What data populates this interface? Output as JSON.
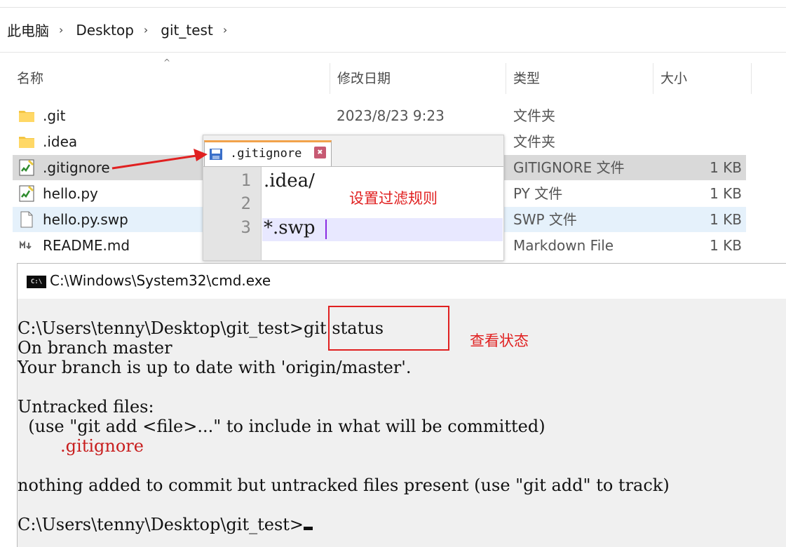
{
  "breadcrumb": {
    "items": [
      "此电脑",
      "Desktop",
      "git_test"
    ]
  },
  "columns": {
    "name": "名称",
    "date": "修改日期",
    "type": "类型",
    "size": "大小"
  },
  "files": [
    {
      "name": ".git",
      "date": "2023/8/23 9:23",
      "type": "文件夹",
      "size": "",
      "icon": "folder-icon"
    },
    {
      "name": ".idea",
      "date": "",
      "type": "文件夹",
      "size": "",
      "icon": "folder-icon"
    },
    {
      "name": ".gitignore",
      "date": "",
      "type": "GITIGNORE 文件",
      "size": "1 KB",
      "icon": "notepad-file-icon"
    },
    {
      "name": "hello.py",
      "date": "",
      "type": "PY 文件",
      "size": "1 KB",
      "icon": "notepad-file-icon"
    },
    {
      "name": "hello.py.swp",
      "date": "",
      "type": "SWP 文件",
      "size": "1 KB",
      "icon": "blank-file-icon"
    },
    {
      "name": "README.md",
      "date": "",
      "type": "Markdown File",
      "size": "1 KB",
      "icon": "markdown-file-icon"
    }
  ],
  "editor": {
    "tab": ".gitignore",
    "close_glyph": "✖",
    "lines": [
      {
        "num": "1",
        "text": ".idea/"
      },
      {
        "num": "2",
        "text": ""
      },
      {
        "num": "3",
        "text": "*.swp"
      }
    ]
  },
  "annotations": {
    "filter_rules": "设置过滤规则",
    "check_status": "查看状态"
  },
  "cmd": {
    "title": "C:\\Windows\\System32\\cmd.exe",
    "icon_text": "C:\\",
    "lines": [
      "C:\\Users\\tenny\\Desktop\\git_test>git status",
      "On branch master",
      "Your branch is up to date with 'origin/master'.",
      "",
      "Untracked files:",
      "  (use \"git add <file>...\" to include in what will be committed)",
      "        .gitignore",
      "",
      "nothing added to commit but untracked files present (use \"git add\" to track)",
      "",
      "C:\\Users\\tenny\\Desktop\\git_test>"
    ]
  }
}
